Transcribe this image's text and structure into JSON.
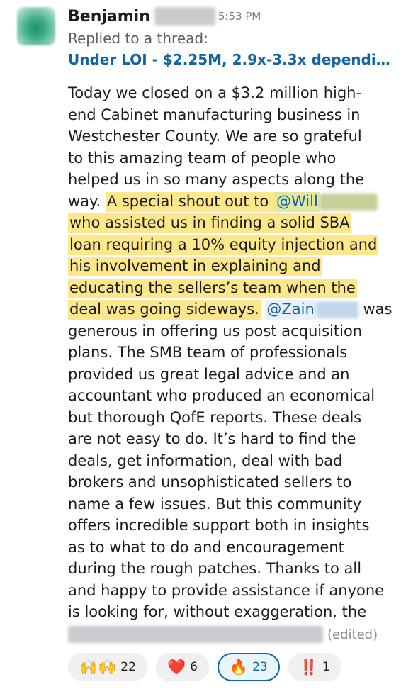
{
  "author": {
    "name": "Benjamin",
    "time": "5:53 PM"
  },
  "thread": {
    "replied_label": "Replied to a thread:",
    "title": "Under LOI - $2.25M, 2.9x-3.3x dependi…"
  },
  "message": {
    "l1": "Today we closed on a $3.2 million high-",
    "l2": "end Cabinet manufacturing business in",
    "l3": "Westchester County. We are so grateful",
    "l4": "to this amazing team of people who",
    "l5": "helped us in so many aspects along the",
    "l6a": "way. ",
    "l6b": "A special shout out to ",
    "mention_will": "@Will",
    "l7": "who assisted us in finding a solid SBA",
    "l8": "loan requiring a 10% equity injection and",
    "l9": "his involvement in explaining and",
    "l10": "educating the sellers’s team when the",
    "l11a": "deal was going sideways.",
    "mention_zain": "@Zain",
    "l11b": " was",
    "l12": "generous in offering us post acquisition",
    "l13": "plans. The SMB team of professionals",
    "l14": "provided us great legal advice and an",
    "l15": "accountant who produced an economical",
    "l16": "but thorough QofE reports. These deals",
    "l17": "are not easy to do. It’s hard to find the",
    "l18": "deals, get information, deal with bad",
    "l19": "brokers and unsophisticated sellers to",
    "l20": "name a few issues. But this community",
    "l21": "offers incredible support both in insights",
    "l22": "as to what to do and encouragement",
    "l23": "during the rough patches. Thanks to all",
    "l24": "and happy to provide assistance if anyone",
    "l25": "is looking for, without exaggeration, the",
    "edited": "(edited)"
  },
  "reactions": [
    {
      "emoji": "🙌🙌",
      "count": "22",
      "active": false
    },
    {
      "emoji": "❤️",
      "count": "6",
      "active": false
    },
    {
      "emoji": "🔥",
      "count": "23",
      "active": true
    },
    {
      "emoji": "‼️",
      "count": "1",
      "active": false
    }
  ],
  "colors": {
    "link": "#1264a3",
    "highlight": "#fce88a",
    "text": "#1d1c1d",
    "muted": "#616061"
  }
}
